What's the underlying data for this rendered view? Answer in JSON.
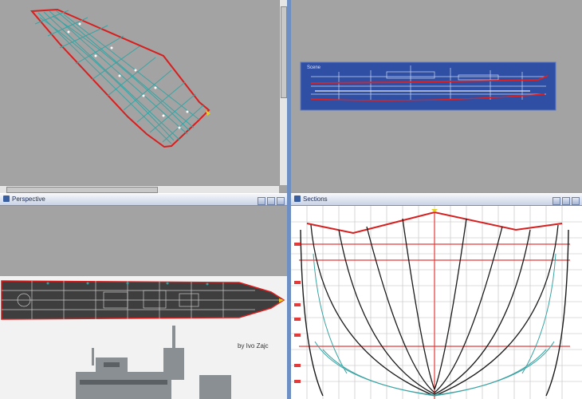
{
  "viewports": {
    "top_left": {
      "label": ""
    },
    "top_right": {
      "label": "Scene"
    },
    "bottom_left": {
      "label": "Perspective"
    },
    "bottom_right": {
      "label": "Sections"
    }
  },
  "photo": {
    "caption": "by Ivo Zajc"
  },
  "colors": {
    "workspace": "#a3a3a3",
    "frame": "#6d8fc4",
    "wire": "#3aa3a3",
    "outline": "#d81f1f",
    "grid_red": "#e53a3a"
  }
}
